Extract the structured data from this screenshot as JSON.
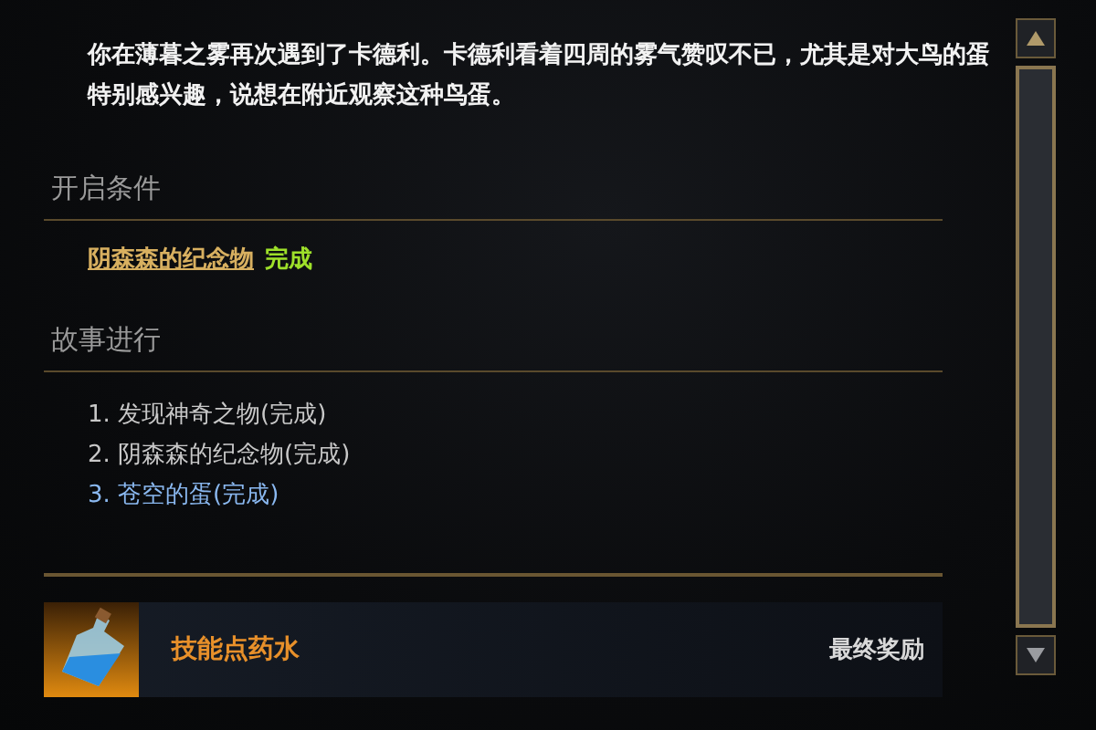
{
  "description": "你在薄暮之雾再次遇到了卡德利。卡德利看着四周的雾气赞叹不已，尤其是对大鸟的蛋特别感兴趣，说想在附近观察这种鸟蛋。",
  "conditions": {
    "title": "开启条件",
    "items": [
      {
        "link": "阴森森的纪念物",
        "status": "完成"
      }
    ]
  },
  "story": {
    "title": "故事进行",
    "steps": [
      {
        "text": "1. 发现神奇之物(完成)",
        "selected": false
      },
      {
        "text": "2. 阴森森的纪念物(完成)",
        "selected": false
      },
      {
        "text": "3. 苍空的蛋(完成)",
        "selected": true
      }
    ]
  },
  "reward": {
    "name": "技能点药水",
    "label": "最终奖励"
  }
}
